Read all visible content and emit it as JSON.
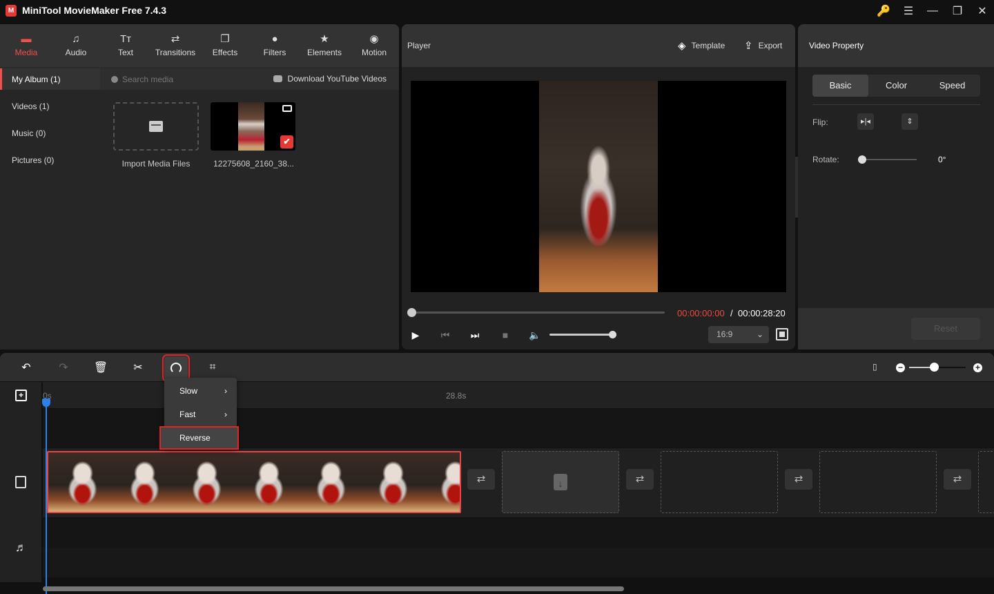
{
  "app": {
    "title": "MiniTool MovieMaker Free 7.4.3",
    "logo_glyph": "M"
  },
  "window_controls": [
    {
      "name": "key-icon",
      "glyph": "🔑"
    },
    {
      "name": "menu-icon",
      "glyph": "☰"
    },
    {
      "name": "minimize-icon",
      "glyph": "—"
    },
    {
      "name": "restore-icon",
      "glyph": "❐"
    },
    {
      "name": "close-icon",
      "glyph": "✕"
    }
  ],
  "nav_tabs": [
    {
      "label": "Media",
      "icon": "▬",
      "active": true
    },
    {
      "label": "Audio",
      "icon": "♫"
    },
    {
      "label": "Text",
      "icon": "Tт"
    },
    {
      "label": "Transitions",
      "icon": "⇄"
    },
    {
      "label": "Effects",
      "icon": "❐"
    },
    {
      "label": "Filters",
      "icon": "●"
    },
    {
      "label": "Elements",
      "icon": "★"
    },
    {
      "label": "Motion",
      "icon": "◉"
    }
  ],
  "album": {
    "items": [
      {
        "label": "My Album (1)",
        "active": true
      },
      {
        "label": "Videos (1)"
      },
      {
        "label": "Music (0)"
      },
      {
        "label": "Pictures (0)"
      }
    ]
  },
  "media": {
    "search_placeholder": "Search media",
    "youtube_label": "Download YouTube Videos",
    "import_label": "Import Media Files",
    "clip_label": "12275608_2160_38...",
    "clip_check": "✔"
  },
  "player": {
    "title": "Player",
    "template_label": "Template",
    "template_icon": "◈",
    "export_label": "Export",
    "export_icon": "⇪",
    "time_current": "00:00:00:00",
    "time_sep": "/",
    "time_total": "00:00:28:20",
    "progress": 0,
    "volume": 1.0,
    "aspect_ratio": "16:9",
    "controls": {
      "play": "▶",
      "prev": "⏮",
      "next": "⏭",
      "stop": "■",
      "volume": "🔈"
    }
  },
  "property": {
    "title": "Video Property",
    "tabs": [
      {
        "label": "Basic",
        "active": true
      },
      {
        "label": "Color"
      },
      {
        "label": "Speed"
      }
    ],
    "flip_label": "Flip:",
    "flip_h_icon": "▸|◂",
    "flip_v_icon": "⇕",
    "rotate_label": "Rotate:",
    "rotate_value": "0°",
    "reset_label": "Reset",
    "collapse_icon": "›"
  },
  "timeline_toolbar": {
    "undo": "↶",
    "redo": "↷",
    "delete": "🗑",
    "split": "✂",
    "crop": "⌗",
    "fit": "▯",
    "zoom_out": "−",
    "zoom_in": "+",
    "zoom_level": 0.44
  },
  "timeline": {
    "add_track": "+",
    "ruler_start": "0s",
    "ruler_end": "28.8s",
    "transition_icon": "⇄",
    "slot_icon": "↓",
    "music_icon": "♬",
    "frame_count": 7
  },
  "speed_menu": {
    "items": [
      {
        "label": "Slow",
        "chevron": "›"
      },
      {
        "label": "Fast",
        "chevron": "›"
      },
      {
        "label": "Reverse"
      }
    ]
  }
}
